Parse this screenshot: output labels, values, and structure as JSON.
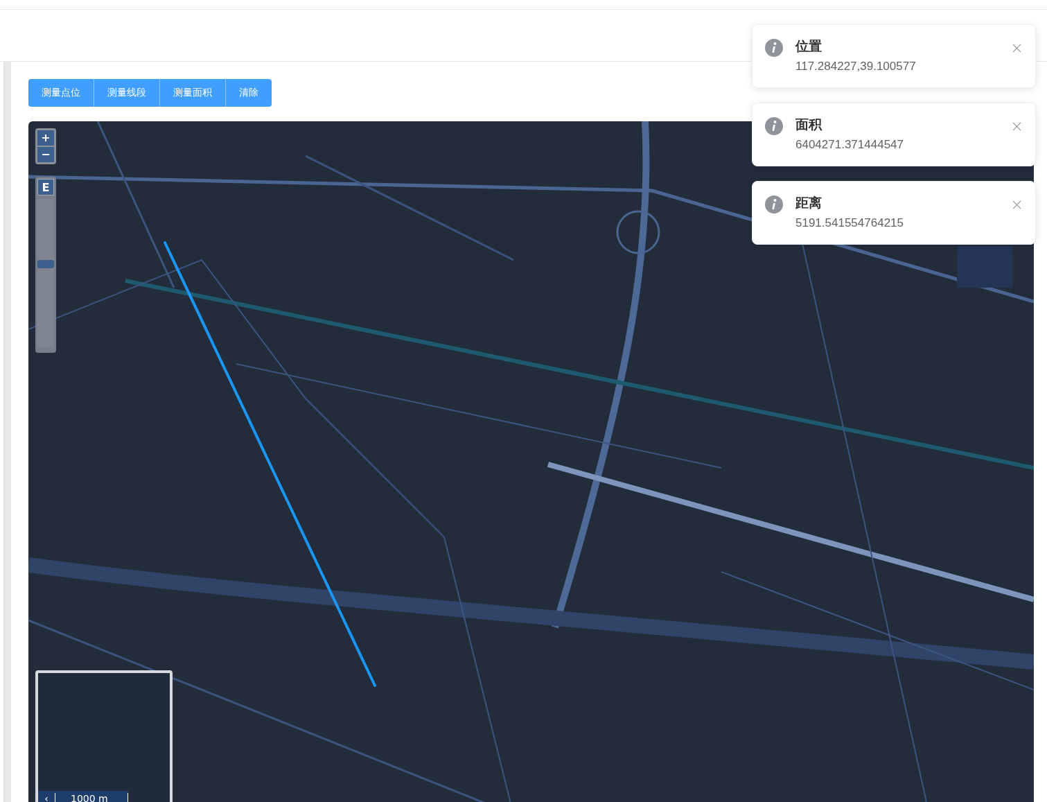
{
  "toolbar": {
    "buttons": [
      "测量点位",
      "测量线段",
      "测量面积",
      "清除"
    ]
  },
  "map": {
    "zoom_in": "+",
    "zoom_out": "−",
    "zoom_label": "E",
    "zoom_slider": {
      "level": 0.56
    },
    "overview_toggle": "‹",
    "scale": "1000 m"
  },
  "notifications": [
    {
      "title": "位置",
      "message": "117.284227,39.100577"
    },
    {
      "title": "面积",
      "message": "6404271.371444547"
    },
    {
      "title": "距离",
      "message": "5191.541554764215"
    }
  ]
}
